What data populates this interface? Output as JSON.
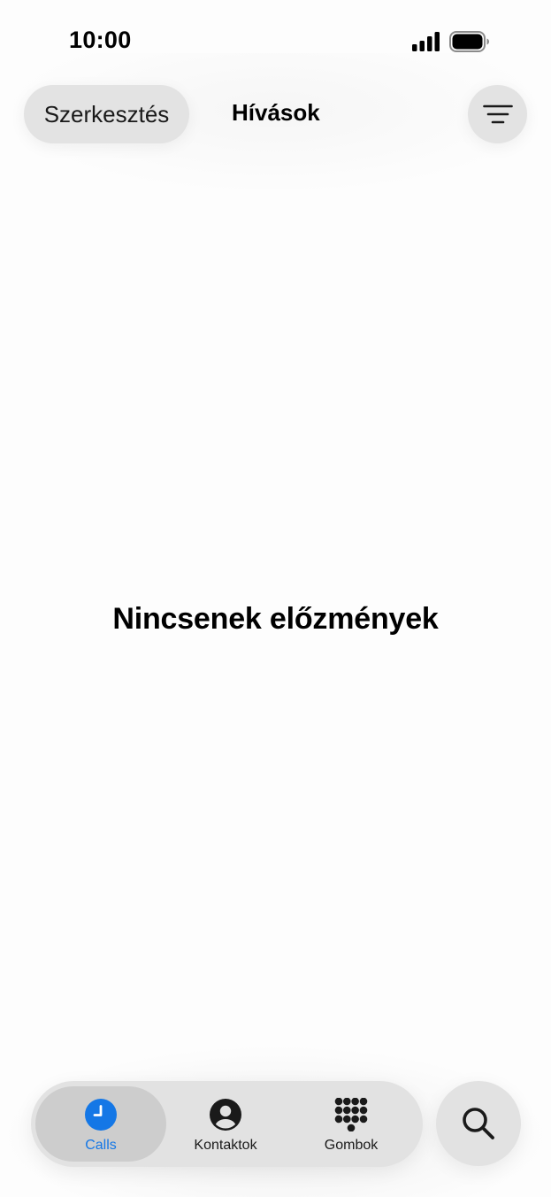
{
  "status_bar": {
    "time": "10:00",
    "icons": [
      "signal-icon",
      "battery-icon"
    ]
  },
  "header": {
    "edit_label": "Szerkesztés",
    "title": "Hívások",
    "filter_icon": "filter-lines-icon"
  },
  "main": {
    "empty_message": "Nincsenek előzmények"
  },
  "tab_bar": {
    "tabs": [
      {
        "label": "Calls",
        "icon": "clock-icon",
        "active": true
      },
      {
        "label": "Kontaktok",
        "icon": "person-icon",
        "active": false
      },
      {
        "label": "Gombok",
        "icon": "keypad-icon",
        "active": false
      }
    ],
    "search_icon": "search-icon"
  },
  "colors": {
    "accent": "#1477e6",
    "background": "#fdfdfd",
    "control": "#e2e2e2"
  }
}
